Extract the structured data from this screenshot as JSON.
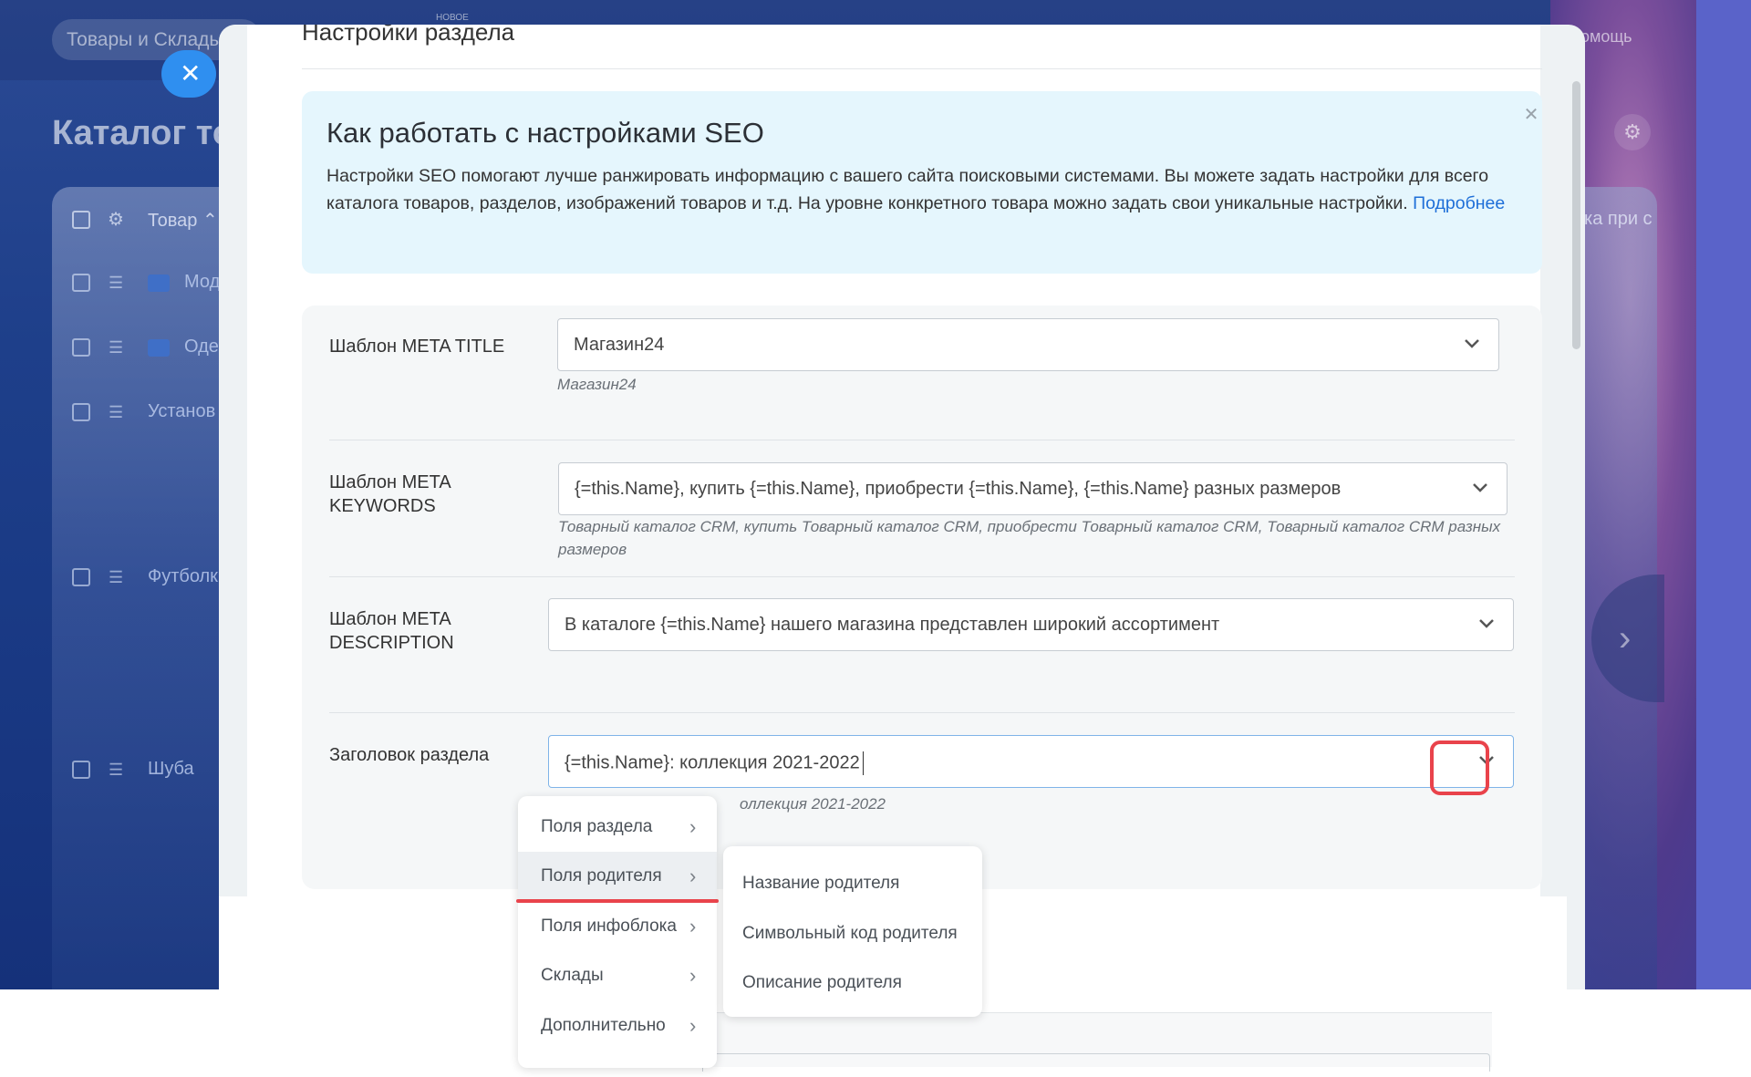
{
  "background": {
    "search_label": "Товары и Склады",
    "new_badge": "НОВОЕ",
    "help_label": "Помощь",
    "page_title": "Каталог то",
    "table_header": {
      "product_col": "Товар",
      "right_col": "ка при с"
    },
    "rows": [
      {
        "label": "Мод"
      },
      {
        "label": "Оде"
      },
      {
        "label": "Установ"
      },
      {
        "label": "Футболк"
      },
      {
        "label": "Шуба"
      }
    ]
  },
  "modal": {
    "title": "Настройки раздела",
    "info": {
      "title": "Как работать с настройками SEO",
      "text": "Настройки SEO помогают лучше ранжировать информацию с вашего сайта поисковыми системами. Вы можете задать настройки для всего каталога товаров, разделов, изображений товаров и т.д. На уровне конкретного товара можно задать свои уникальные настройки.",
      "link": "Подробнее"
    },
    "fields": {
      "meta_title": {
        "label": "Шаблон META TITLE",
        "value": "Магазин24",
        "hint": "Магазин24"
      },
      "meta_keywords": {
        "label": "Шаблон META KEYWORDS",
        "value": "{=this.Name}, купить {=this.Name}, приобрести {=this.Name}, {=this.Name} разных размеров",
        "hint": "Товарный каталог CRM, купить Товарный каталог CRM, приобрести Товарный каталог CRM, Товарный каталог CRM разных размеров"
      },
      "meta_description": {
        "label": "Шаблон META DESCRIPTION",
        "value": "В каталоге {=this.Name} нашего магазина представлен широкий ассортимент"
      },
      "section_heading": {
        "label": "Заголовок раздела",
        "value": "{=this.Name}: коллекция 2021-2022",
        "hint": "оллекция 2021-2022"
      }
    }
  },
  "menu": {
    "items": [
      {
        "label": "Поля раздела"
      },
      {
        "label": "Поля родителя"
      },
      {
        "label": "Поля инфоблока"
      },
      {
        "label": "Склады"
      },
      {
        "label": "Дополнительно"
      }
    ],
    "selected": "Поля родителя",
    "submenu": [
      {
        "label": "Название родителя"
      },
      {
        "label": "Символьный код родителя"
      },
      {
        "label": "Описание родителя"
      }
    ]
  },
  "colors": {
    "accent": "#2f8ff0",
    "highlight": "#e9434b",
    "link": "#1f6fd8",
    "info_bg": "#e5f6fd"
  }
}
